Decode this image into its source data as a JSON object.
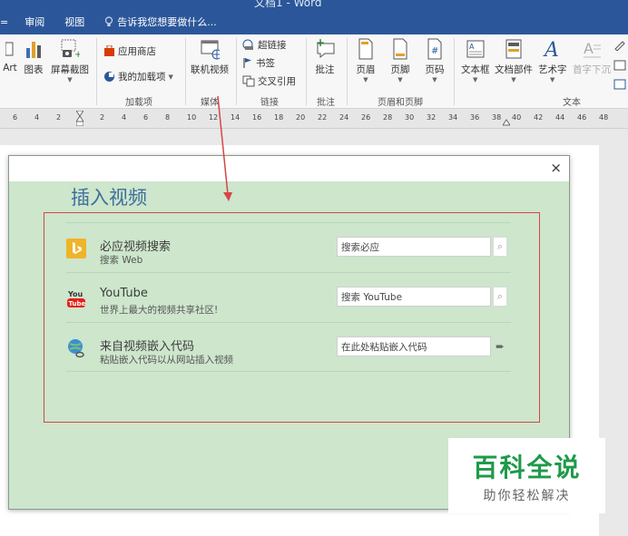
{
  "window": {
    "title": "文档1 - Word"
  },
  "menu": {
    "items": [
      "审阅",
      "视图"
    ],
    "tell_me": "告诉我您想要做什么...",
    "left_glyph": "="
  },
  "ribbon": {
    "buttons": {
      "smartart": "Art",
      "chart": "图表",
      "screenshot": "屏幕截图",
      "store": "应用商店",
      "my_addins": "我的加载项",
      "online_video": "联机视频",
      "hyperlink": "超链接",
      "bookmark": "书签",
      "cross_ref": "交叉引用",
      "comment": "批注",
      "header": "页眉",
      "footer": "页脚",
      "page_number": "页码",
      "textbox": "文本框",
      "quick_parts": "文档部件",
      "wordart": "艺术字",
      "dropcap": "首字下沉"
    },
    "groups": {
      "addins": "加载项",
      "media": "媒体",
      "links": "链接",
      "comments": "批注",
      "header_footer": "页眉和页脚",
      "text": "文本"
    }
  },
  "ruler": {
    "ticks": [
      "6",
      "4",
      "2",
      "2",
      "4",
      "6",
      "8",
      "10",
      "12",
      "14",
      "16",
      "18",
      "20",
      "22",
      "24",
      "26",
      "28",
      "30",
      "32",
      "34",
      "36",
      "38",
      "40",
      "42",
      "44",
      "46",
      "48"
    ]
  },
  "dialog": {
    "title": "插入视频",
    "close_glyph": "×",
    "sources": [
      {
        "name": "必应视频搜索",
        "desc": "搜索 Web",
        "placeholder": "搜索必应",
        "action_icon": "search-icon"
      },
      {
        "name": "YouTube",
        "desc": "世界上最大的视频共享社区!",
        "placeholder": "搜索 YouTube",
        "action_icon": "search-icon"
      },
      {
        "name": "来自视频嵌入代码",
        "desc": "粘贴嵌入代码以从网站插入视频",
        "placeholder": "在此处粘贴嵌入代码",
        "action_icon": "arrow-right-icon"
      }
    ]
  },
  "watermark": {
    "title": "百科全说",
    "subtitle": "助你轻松解决"
  },
  "colors": {
    "titlebar": "#2b579a",
    "dialog_bg": "#cde6cc",
    "highlight_frame": "#d64646",
    "arrow": "#d64646",
    "watermark_text": "#1f9a4a"
  }
}
